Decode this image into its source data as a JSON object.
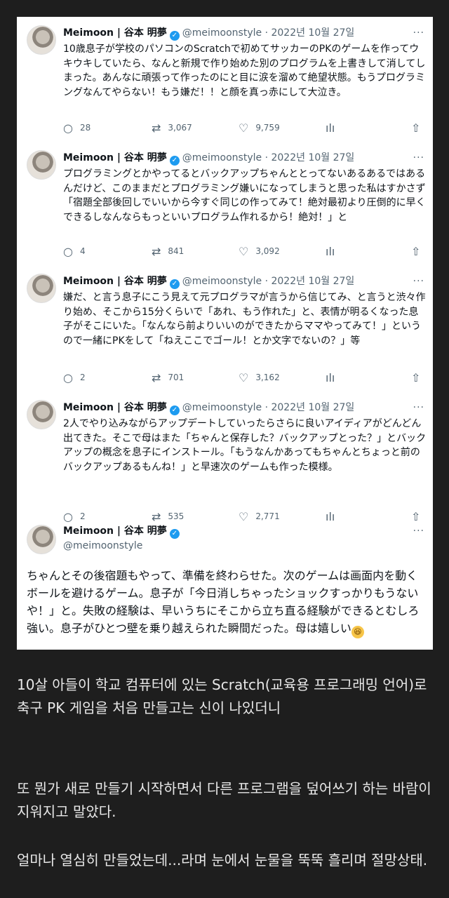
{
  "author": {
    "name": "Meimoon | 谷本 明夢",
    "handle": "@meimoonstyle",
    "date": "2022년 10월 27일",
    "verified_mark": "✓",
    "more_icon": "···"
  },
  "tweets": [
    {
      "text": "10歳息子が学校のパソコンのScratchで初めてサッカーのPKのゲームを作ってウキウキしていたら、なんと新規で作り始めた別のプログラムを上書きして消してしまった。あんなに頑張って作ったのにと目に涙を溜めて絶望状態。もうプログラミングなんてやらない！もう嫌だ！！と顔を真っ赤にして大泣き。",
      "replies": "28",
      "retweets": "3,067",
      "likes": "9,759"
    },
    {
      "text": "プログラミングとかやってるとバックアップちゃんととってないあるあるではあるんだけど、このままだとプログラミング嫌いになってしまうと思った私はすかさず「宿題全部後回しでいいから今すぐ同じの作ってみて！絶対最初より圧倒的に早くできるしなんならもっといいプログラム作れるから！絶対！」と",
      "replies": "4",
      "retweets": "841",
      "likes": "3,092"
    },
    {
      "text": "嫌だ、と言う息子にこう見えて元プログラマが言うから信じてみ、と言うと渋々作り始め、そこから15分くらいで「あれ、もう作れた」と、表情が明るくなった息子がそこにいた。「なんなら前よりいいのができたからママやってみて！」というので一緒にPKをして「ねえここでゴール！とか文字でないの？」等",
      "replies": "2",
      "retweets": "701",
      "likes": "3,162"
    },
    {
      "text": "2人でやり込みながらアップデートしていったらさらに良いアイディアがどんどん出てきた。そこで母はまた「ちゃんと保存した？バックアップとった？」とバックアップの概念を息子にインストール。「もうなんかあってもちゃんとちょっと前のバックアップあるもんね！」と早速次のゲームも作った模様。",
      "replies": "2",
      "retweets": "535",
      "likes": "2,771"
    }
  ],
  "last_tweet": {
    "text": "ちゃんとその後宿題もやって、準備を終わらせた。次のゲームは画面内を動くボールを避けるゲーム。息子が「今日消しちゃったショックすっかりもうないや！」と。失敗の経験は、早いうちにそこから立ち直る経験ができるとむしろ強い。息子がひとつ壁を乗り越えられた瞬間だった。母は嬉しい",
    "emoji": "😆"
  },
  "icons": {
    "reply": "○",
    "retweet": "⇄",
    "like": "♡",
    "analytics": "ılı",
    "share": "⇧"
  },
  "caption": [
    "10살 아들이 학교 컴퓨터에 있는 Scratch(교육용 프로그래밍 언어)로 축구 PK 게임을 처음 만들고는 신이 나있더니",
    "또 뭔가 새로 만들기 시작하면서 다른 프로그램을 덮어쓰기 하는 바람이 지워지고 말았다.",
    "얼마나 열심히 만들었는데...라며 눈에서 눈물을 뚝뚝 흘리며 절망상태."
  ]
}
